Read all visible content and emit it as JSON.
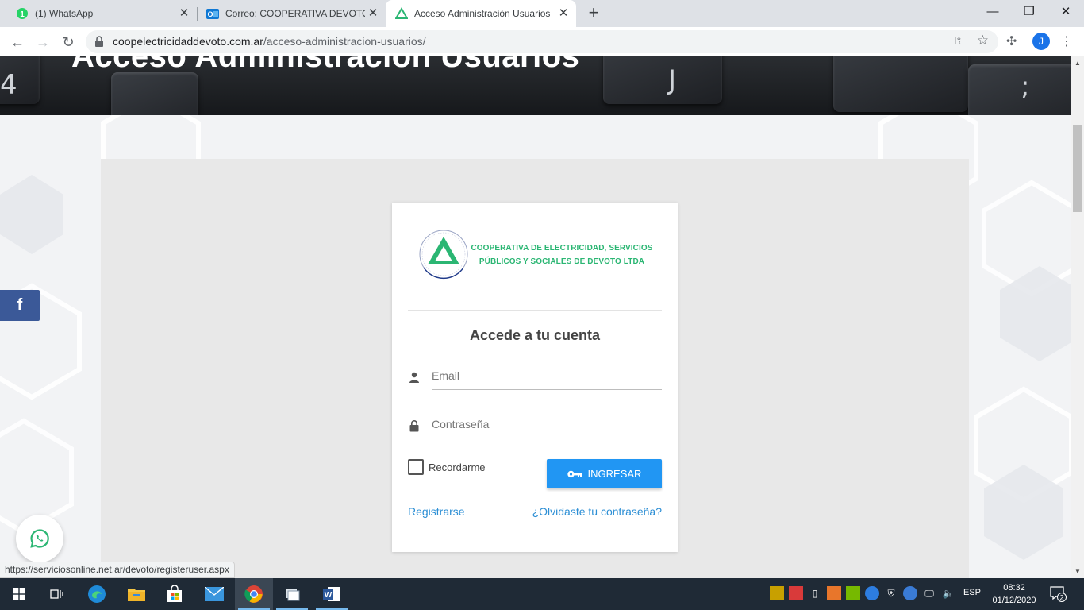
{
  "browser": {
    "tabs": [
      {
        "title": "(1) WhatsApp",
        "active": false,
        "badge": "1"
      },
      {
        "title": "Correo: COOPERATIVA DEVOTO -",
        "active": false
      },
      {
        "title": "Acceso Administración Usuarios",
        "active": true
      }
    ],
    "address": {
      "domain": "coopelectricidaddevoto.com.ar",
      "path": "/acceso-administracion-usuarios/"
    },
    "profile_initial": "J"
  },
  "page": {
    "hero_title": "Acceso Administración Usuarios",
    "logo_text_line1": "COOPERATIVA DE ELECTRICIDAD, SERVICIOS",
    "logo_text_line2": "PÚBLICOS Y SOCIALES DE DEVOTO LTDA",
    "login": {
      "title": "Accede a tu cuenta",
      "email_placeholder": "Email",
      "password_placeholder": "Contraseña",
      "remember_label": "Recordarme",
      "submit_label": "INGRESAR",
      "register_link": "Registrarse",
      "forgot_link": "¿Olvidaste tu contraseña?"
    },
    "facebook_label": "f",
    "status_url": "https://serviciosonline.net.ar/devoto/registeruser.aspx"
  },
  "taskbar": {
    "language": "ESP",
    "time": "08:32",
    "date": "01/12/2020",
    "notification_count": "2"
  },
  "colors": {
    "accent_blue": "#2196f3",
    "brand_green": "#2bb673",
    "facebook": "#3b5998",
    "link": "#2d8fd5"
  }
}
